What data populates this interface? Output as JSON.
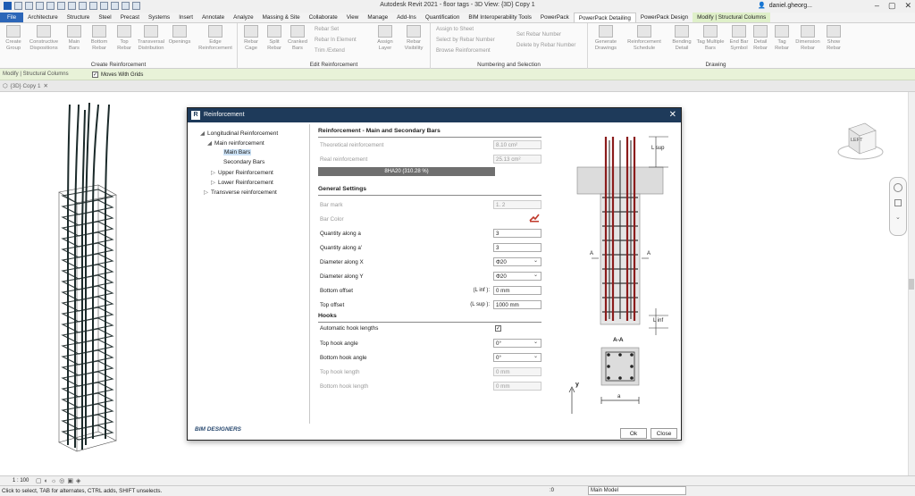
{
  "app": {
    "title": "Autodesk Revit 2021 - floor tags - 3D View: {3D} Copy 1",
    "user": "daniel.gheorg...",
    "window_controls": [
      "–",
      "▢",
      "✕"
    ]
  },
  "tabs": [
    "File",
    "Architecture",
    "Structure",
    "Steel",
    "Precast",
    "Systems",
    "Insert",
    "Annotate",
    "Analyze",
    "Massing & Site",
    "Collaborate",
    "View",
    "Manage",
    "Add-Ins",
    "Quantification",
    "BIM Interoperability Tools",
    "PowerPack",
    "PowerPack Detailing",
    "PowerPack Design",
    "Modify | Structural Columns"
  ],
  "ribbon": {
    "groups": [
      {
        "label": "Create Reinforcement",
        "buttons": [
          "Create Group",
          "Constructive Dispositions",
          "Main Bars",
          "Bottom Rebar",
          "Top Rebar",
          "Transversal Distribution",
          "Openings",
          "Edge Reinforcement"
        ]
      },
      {
        "label": "Edit Reinforcement",
        "buttons": [
          "Rebar Cage",
          "Split Rebar",
          "Cranked Bars",
          "Assign Layer",
          "Rebar Visibility"
        ],
        "small": [
          "Rebar Set",
          "Rebar In Element",
          "Trim /Extend"
        ]
      },
      {
        "label": "Numbering and Selection",
        "small": [
          "Assign to Sheet",
          "Select by Rebar Number",
          "Browse Reinforcement",
          "Set Rebar Number",
          "Delete by Rebar Number"
        ]
      },
      {
        "label": "Drawing",
        "buttons": [
          "Generate Drawings",
          "Reinforcement Schedule",
          "Bending Detail",
          "Tag Multiple Bars",
          "End Bar Symbol",
          "Detail Rebar",
          "Tag Rebar",
          "Dimension Rebar",
          "Show Rebar"
        ]
      }
    ]
  },
  "options_bar": {
    "mode": "Modify | Structural Columns",
    "moves_with_grids": "Moves With Grids"
  },
  "view_tab": "{3D} Copy 1",
  "viewcube_face": "LEFT",
  "dialog": {
    "title": "Reinforcement",
    "tree": [
      {
        "label": "Longitudinal Reinforcement",
        "arrow": "◢"
      },
      {
        "label": "Main reinforcement",
        "arrow": "◢"
      },
      {
        "label": "Main Bars"
      },
      {
        "label": "Secondary Bars"
      },
      {
        "label": "Upper Reinforcement",
        "arrow": "▷"
      },
      {
        "label": "Lower Reinforcement",
        "arrow": "▷"
      },
      {
        "label": "Transverse reinforcement",
        "arrow": "▷"
      }
    ],
    "sections": {
      "main": "Reinforcement - Main and Secondary Bars",
      "general": "General Settings",
      "hooks": "Hooks"
    },
    "fields": {
      "theoretical_label": "Theoretical reinforcement",
      "theoretical_value": "8.10 cm²",
      "real_label": "Real reinforcement",
      "real_value": "25.13 cm²",
      "bar_text": "8HA20   (310.28 %)",
      "bar_mark_label": "Bar mark",
      "bar_mark_value": "1. 2",
      "bar_color_label": "Bar Color",
      "qty_a_label": "Quantity along a",
      "qty_a_value": "3",
      "qty_a2_label": "Quantity along a'",
      "qty_a2_value": "3",
      "dia_x_label": "Diameter along X",
      "dia_x_value": "Φ20",
      "dia_y_label": "Diameter along Y",
      "dia_y_value": "Φ20",
      "bottom_offset_label": "Bottom offset",
      "bottom_offset_suffix": "(L inf ):",
      "bottom_offset_value": "0 mm",
      "top_offset_label": "Top offset",
      "top_offset_suffix": "(L sup ):",
      "top_offset_value": "1000 mm",
      "auto_hook_label": "Automatic hook lengths",
      "top_hook_angle_label": "Top hook angle",
      "top_hook_angle_value": "0°",
      "bottom_hook_angle_label": "Bottom hook angle",
      "bottom_hook_angle_value": "0°",
      "top_hook_length_label": "Top hook length",
      "top_hook_length_value": "0 mm",
      "bottom_hook_length_label": "Bottom hook length",
      "bottom_hook_length_value": "0 mm"
    },
    "drawing_labels": {
      "l_sup": "L sup",
      "l_inf": "L inf",
      "section": "A-A",
      "a_left": "A",
      "a_right": "A",
      "y": "y",
      "a_dim": "a"
    },
    "ok": "Ok",
    "close": "Close",
    "brand": "BIM DESIGNERS"
  },
  "status": {
    "text": "Click to select, TAB for alternates, CTRL adds, SHIFT unselects.",
    "scale": "1 : 100",
    "model": "Main Model",
    "counter": ":0"
  },
  "colors": {
    "file_tab": "#2c66b8",
    "dialog_title": "#1e3a5a",
    "context_tab": "#dff0c9",
    "rebar_red": "#8b1c1c"
  }
}
